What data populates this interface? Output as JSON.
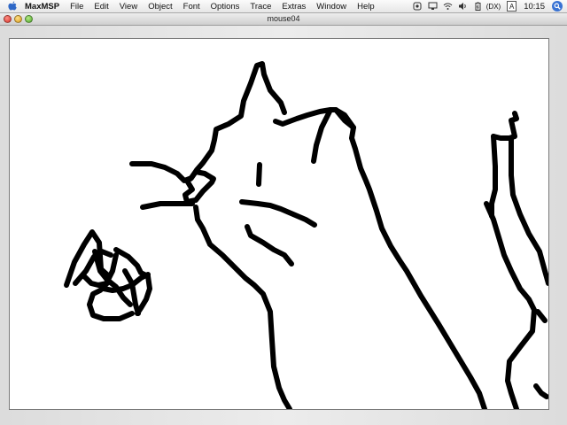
{
  "menubar": {
    "app_name": "MaxMSP",
    "items": [
      "File",
      "Edit",
      "View",
      "Object",
      "Font",
      "Options",
      "Trace",
      "Extras",
      "Window",
      "Help"
    ],
    "status_text": "(DX)",
    "clock": "10:15",
    "status_icons": [
      "maxmsp-status-icon",
      "display-icon",
      "airport-icon",
      "volume-icon",
      "battery-icon",
      "input-menu-icon",
      "spotlight-icon"
    ]
  },
  "window": {
    "title": "mouse04",
    "controls": [
      "close-button",
      "minimize-button",
      "zoom-button"
    ]
  },
  "canvas": {
    "content": "freehand black line drawing of a cat with a ball of yarn"
  }
}
